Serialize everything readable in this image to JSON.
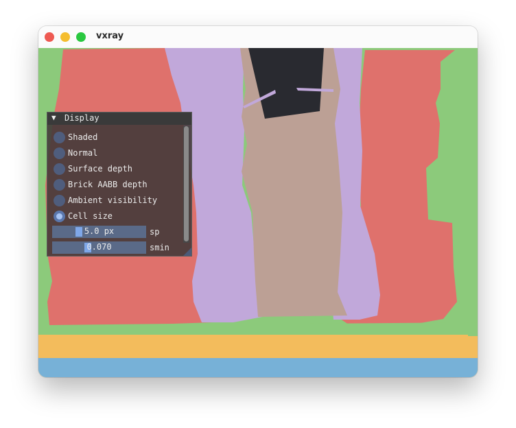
{
  "window": {
    "title": "vxray",
    "buttons": [
      "close",
      "minimize",
      "maximize"
    ]
  },
  "scene": {
    "colors": {
      "green": "#8cca7b",
      "red": "#df716c",
      "lavender": "#c1a8da",
      "taupe": "#bca095",
      "dark": "#292a30",
      "yellow": "#f3bc5c",
      "blue": "#77b1d7"
    }
  },
  "panel": {
    "title": "Display",
    "collapse_icon": "▼",
    "modes": [
      {
        "label": "Shaded",
        "selected": false
      },
      {
        "label": "Normal",
        "selected": false
      },
      {
        "label": "Surface depth",
        "selected": false
      },
      {
        "label": "Brick AABB depth",
        "selected": false
      },
      {
        "label": "Ambient visibility",
        "selected": false
      },
      {
        "label": "Cell size",
        "selected": true
      }
    ],
    "sliders": [
      {
        "value": "5.0 px",
        "label": "sp",
        "fraction": 0.29
      },
      {
        "value": "0.070",
        "label": "smin",
        "fraction": 0.38
      }
    ],
    "colors": {
      "background": "#443a3a",
      "header": "#3a3a3a",
      "radio": "#4f5d7d",
      "radio_active": "#a7c4f4",
      "slider": "#5a6a88",
      "slider_grab": "#7fa7e8"
    }
  }
}
